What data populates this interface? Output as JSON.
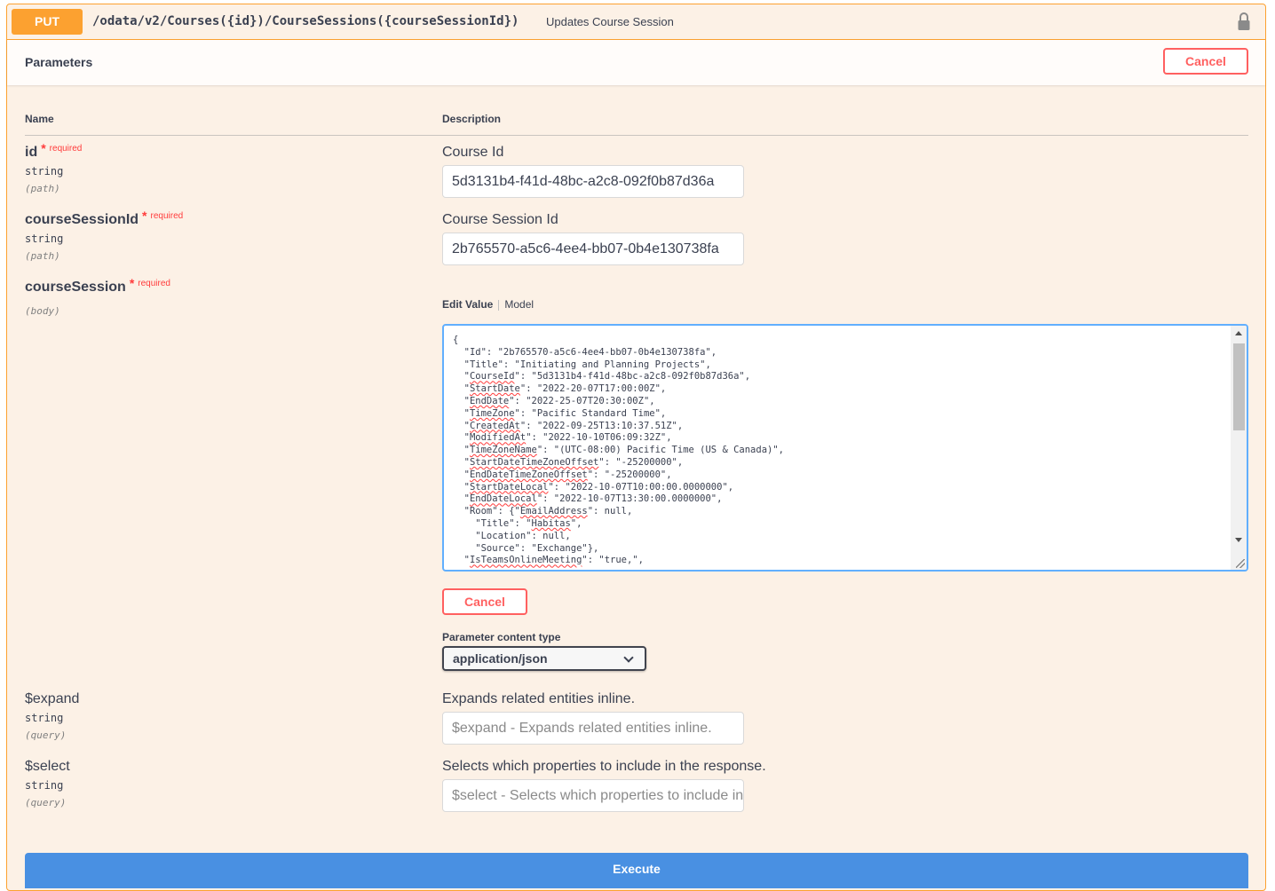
{
  "operation": {
    "method": "PUT",
    "path": "/odata/v2/Courses({id})/CourseSessions({courseSessionId})",
    "summary": "Updates Course Session",
    "lock_icon": "lock-icon"
  },
  "section": {
    "title": "Parameters",
    "cancel_label": "Cancel"
  },
  "columns": {
    "name": "Name",
    "description": "Description"
  },
  "params": {
    "id": {
      "name": "id",
      "star": "*",
      "required": "required",
      "type": "string",
      "in": "(path)",
      "description": "Course Id",
      "value": "5d3131b4-f41d-48bc-a2c8-092f0b87d36a"
    },
    "courseSessionId": {
      "name": "courseSessionId",
      "star": "*",
      "required": "required",
      "type": "string",
      "in": "(path)",
      "description": "Course Session Id",
      "value": "2b765570-a5c6-4ee4-bb07-0b4e130738fa"
    },
    "courseSession": {
      "name": "courseSession",
      "star": "*",
      "required": "required",
      "in": "(body)",
      "tab_edit": "Edit Value",
      "tab_model": "Model",
      "body_lines": [
        "{",
        "  \"Id\": \"2b765570-a5c6-4ee4-bb07-0b4e130738fa\",",
        "  \"Title\": \"Initiating and Planning Projects\",",
        "  \"CourseId\": \"5d3131b4-f41d-48bc-a2c8-092f0b87d36a\",",
        "  \"StartDate\": \"2022-20-07T17:00:00Z\",",
        "  \"EndDate\": \"2022-25-07T20:30:00Z\",",
        "  \"TimeZone\": \"Pacific Standard Time\",",
        "  \"CreatedAt\": \"2022-09-25T13:10:37.51Z\",",
        "  \"ModifiedAt\": \"2022-10-10T06:09:32Z\",",
        "  \"TimeZoneName\": \"(UTC-08:00) Pacific Time (US & Canada)\",",
        "  \"StartDateTimeZoneOffset\": \"-25200000\",",
        "  \"EndDateTimeZoneOffset\": \"-25200000\",",
        "  \"StartDateLocal\": \"2022-10-07T10:00:00.0000000\",",
        "  \"EndDateLocal\": \"2022-10-07T13:30:00.0000000\",",
        "  \"Room\": {\"EmailAddress\": null,",
        "    \"Title\": \"Habitas\",",
        "    \"Location\": null,",
        "    \"Source\": \"Exchange\"},",
        "  \"IsTeamsOnlineMeeting\": \"true,\","
      ],
      "cancel_label": "Cancel",
      "content_type_label": "Parameter content type",
      "content_type_value": "application/json"
    },
    "expand": {
      "name": "$expand",
      "type": "string",
      "in": "(query)",
      "description": "Expands related entities inline.",
      "placeholder": "$expand - Expands related entities inline."
    },
    "select": {
      "name": "$select",
      "type": "string",
      "in": "(query)",
      "description": "Selects which properties to include in the response.",
      "placeholder": "$select - Selects which properties to include in the response."
    }
  },
  "execute_label": "Execute",
  "colors": {
    "put": "#fca130",
    "cancel": "#ff6060",
    "execute": "#4990e2",
    "editor_border": "#61affe"
  }
}
